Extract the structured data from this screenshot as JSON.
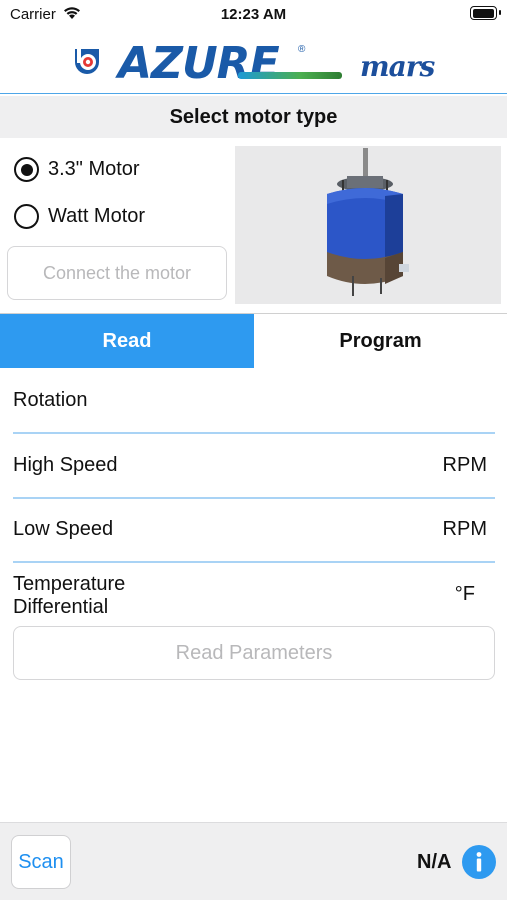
{
  "status_bar": {
    "carrier": "Carrier",
    "time": "12:23 AM",
    "battery_level": 1.0
  },
  "header": {
    "brand_name": "AZURE",
    "brand_registered": "®",
    "partner_logo": "mars"
  },
  "motor_type": {
    "title": "Select motor type",
    "options": [
      {
        "label": "3.3\" Motor",
        "selected": true
      },
      {
        "label": "Watt Motor",
        "selected": false
      }
    ],
    "connect_label": "Connect the motor"
  },
  "tabs": [
    {
      "label": "Read",
      "active": true
    },
    {
      "label": "Program",
      "active": false
    }
  ],
  "parameters": {
    "rotation": {
      "label": "Rotation",
      "unit": ""
    },
    "high_speed": {
      "label": "High Speed",
      "unit": "RPM"
    },
    "low_speed": {
      "label": "Low Speed",
      "unit": "RPM"
    },
    "temp_diff": {
      "label_line1": "Temperature",
      "label_line2": "Differential",
      "unit": "°F"
    },
    "read_button_label": "Read Parameters"
  },
  "bottom_bar": {
    "scan_label": "Scan",
    "status_value": "N/A",
    "info_icon": "info-icon"
  },
  "colors": {
    "accent_blue": "#2e9af0",
    "divider_blue": "#a9d3f5",
    "disabled_text": "#b8b8ba",
    "brand_blue": "#1a5aa8"
  }
}
